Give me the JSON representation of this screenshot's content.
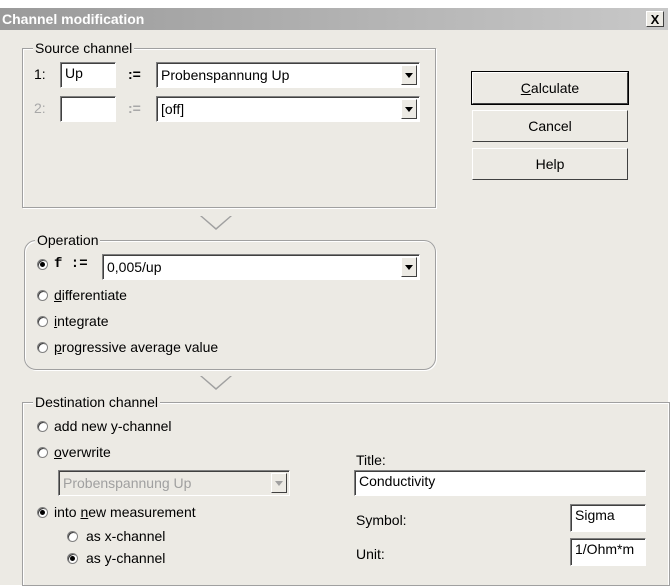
{
  "window": {
    "title": "Channel modification",
    "close_label": "X"
  },
  "source": {
    "legend": "Source channel",
    "row1": {
      "num": "1:",
      "name": "Up",
      "assign": ":=",
      "select": "Probenspannung Up"
    },
    "row2": {
      "num": "2:",
      "name": "",
      "assign": ":=",
      "select": "[off]"
    }
  },
  "buttons": {
    "calculate": "Calculate",
    "calculate_mnemonic": "C",
    "calculate_rest": "alculate",
    "cancel": "Cancel",
    "help": "Help"
  },
  "operation": {
    "legend": "Operation",
    "f_label": "f :=",
    "f_value": "0,005/up",
    "differentiate_m": "d",
    "differentiate_rest": "ifferentiate",
    "integrate_m": "i",
    "integrate_rest": "ntegrate",
    "progressive_m": "p",
    "progressive_rest": "rogressive average value",
    "selected": "f"
  },
  "destination": {
    "legend": "Destination channel",
    "add_new": "add new y-channel",
    "overwrite_m": "o",
    "overwrite_rest": "verwrite",
    "overwrite_select": "Probenspannung Up",
    "into_new_pre": "into ",
    "into_new_m": "n",
    "into_new_rest": "ew measurement",
    "as_x": "as x-channel",
    "as_y": "as y-channel",
    "title_label": "Title:",
    "title_value": "Conductivity",
    "symbol_label": "Symbol:",
    "symbol_value": "Sigma",
    "unit_label": "Unit:",
    "unit_value": "1/Ohm*m"
  }
}
